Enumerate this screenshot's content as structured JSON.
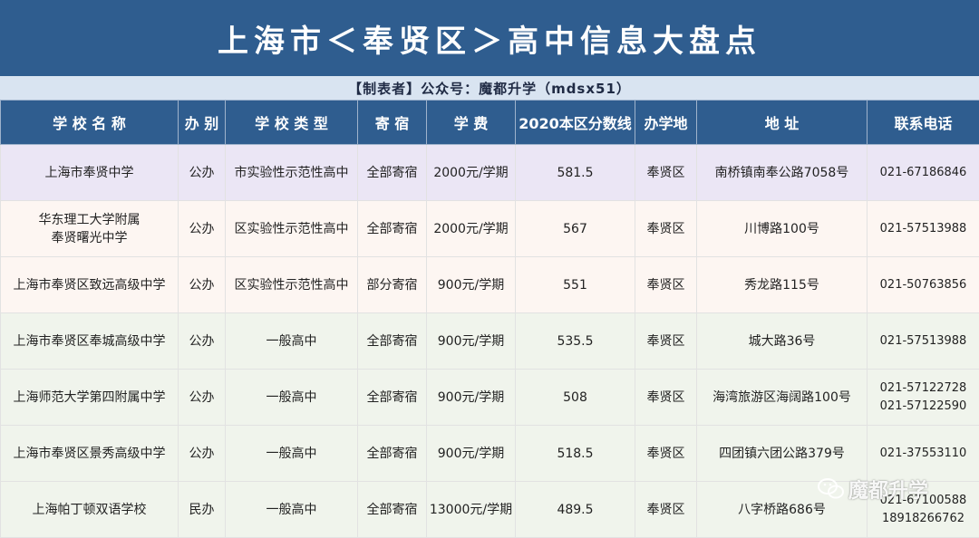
{
  "title": "上海市＜奉贤区＞高中信息大盘点",
  "subtitle": "【制表者】公众号：魔都升学（mdsx51）",
  "headers": [
    "学 校 名 称",
    "办 别",
    "学 校 类 型",
    "寄 宿",
    "学 费",
    "2020本区分数线",
    "办学地",
    "地 址",
    "联系电话"
  ],
  "rows": [
    {
      "name": "上海市奉贤中学",
      "type": "公办",
      "category": "市实验性示范性高中",
      "boarding": "全部寄宿",
      "fee": "2000元/学期",
      "score": "581.5",
      "district": "奉贤区",
      "address": "南桥镇南奉公路7058号",
      "phone": "021-67186846"
    },
    {
      "name": "华东理工大学附属\n奉贤曙光中学",
      "type": "公办",
      "category": "区实验性示范性高中",
      "boarding": "全部寄宿",
      "fee": "2000元/学期",
      "score": "567",
      "district": "奉贤区",
      "address": "川博路100号",
      "phone": "021-57513988"
    },
    {
      "name": "上海市奉贤区致远高级中学",
      "type": "公办",
      "category": "区实验性示范性高中",
      "boarding": "部分寄宿",
      "fee": "900元/学期",
      "score": "551",
      "district": "奉贤区",
      "address": "秀龙路115号",
      "phone": "021-50763856"
    },
    {
      "name": "上海市奉贤区奉城高级中学",
      "type": "公办",
      "category": "一般高中",
      "boarding": "全部寄宿",
      "fee": "900元/学期",
      "score": "535.5",
      "district": "奉贤区",
      "address": "城大路36号",
      "phone": "021-57513988"
    },
    {
      "name": "上海师范大学第四附属中学",
      "type": "公办",
      "category": "一般高中",
      "boarding": "全部寄宿",
      "fee": "900元/学期",
      "score": "508",
      "district": "奉贤区",
      "address": "海湾旅游区海阔路100号",
      "phone": "021-57122728\n021-57122590"
    },
    {
      "name": "上海市奉贤区景秀高级中学",
      "type": "公办",
      "category": "一般高中",
      "boarding": "全部寄宿",
      "fee": "900元/学期",
      "score": "518.5",
      "district": "奉贤区",
      "address": "四团镇六团公路379号",
      "phone": "021-37553110"
    },
    {
      "name": "上海帕丁顿双语学校",
      "type": "民办",
      "category": "一般高中",
      "boarding": "全部寄宿",
      "fee": "13000元/学期",
      "score": "489.5",
      "district": "奉贤区",
      "address": "八字桥路686号",
      "phone": "021-67100588\n18918266762"
    }
  ],
  "watermark": "魔都升学",
  "colors": {
    "header_bg": "#2f5d8f",
    "subtitle_bg": "#d9e4f1"
  }
}
